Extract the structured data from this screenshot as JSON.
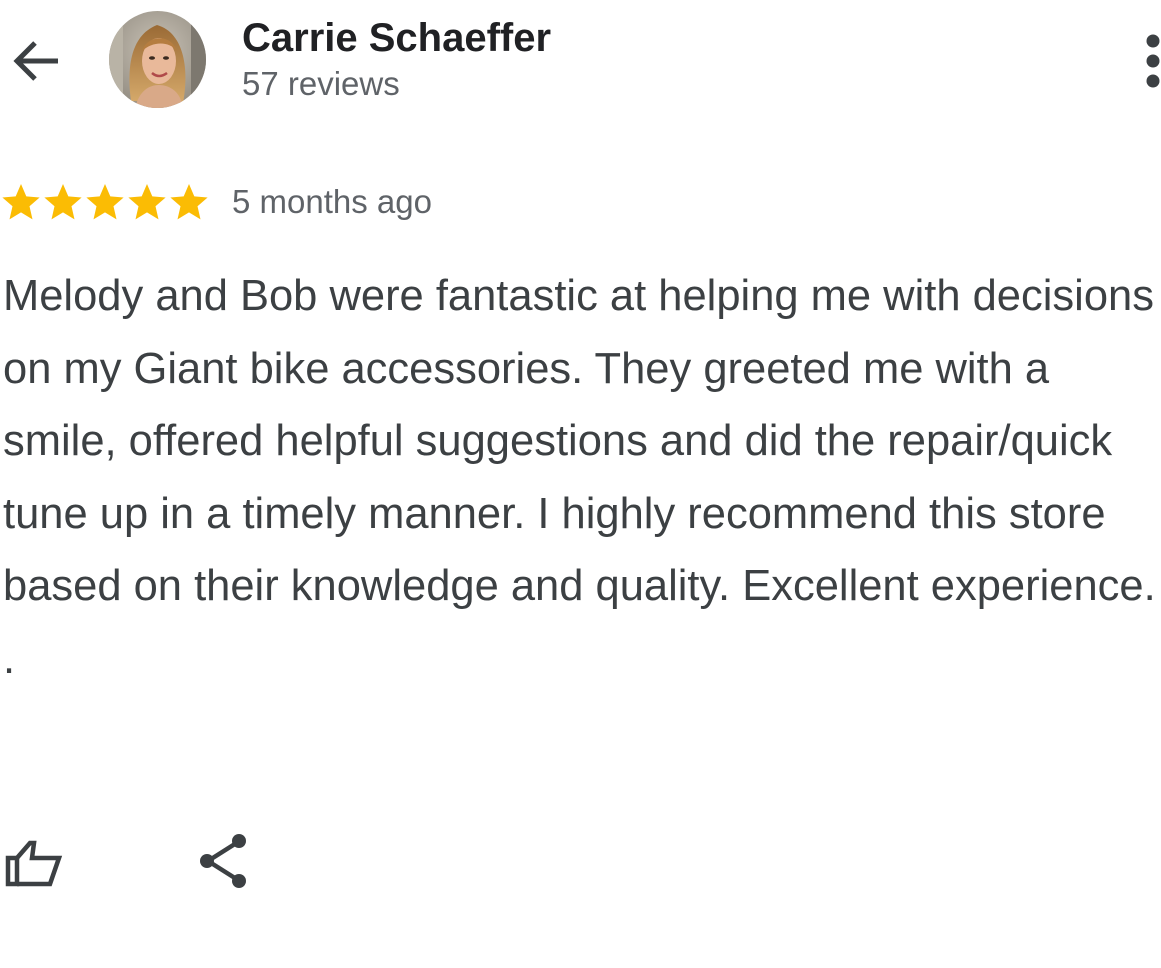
{
  "header": {
    "back_icon": "arrow-back-icon",
    "author_name": "Carrie Schaeffer",
    "review_count": "57 reviews",
    "more_icon": "more-vert-icon"
  },
  "review": {
    "rating": 5,
    "rating_max": 5,
    "star_color": "#fbbc04",
    "time_ago": "5 months ago",
    "text": "Melody and Bob were fantastic at helping me with decisions on my Giant bike accessories. They greeted me with a smile, offered helpful suggestions and did the repair/quick tune up in a timely manner. I highly recommend this store based on their knowledge and quality. Excellent experience.",
    "trailing_text": "."
  },
  "actions": {
    "like_icon": "thumbs-up-icon",
    "share_icon": "share-icon"
  },
  "colors": {
    "primary_text": "#202124",
    "secondary_text": "#5f6368",
    "body_text": "#3c4043",
    "icon": "#3c4043"
  }
}
